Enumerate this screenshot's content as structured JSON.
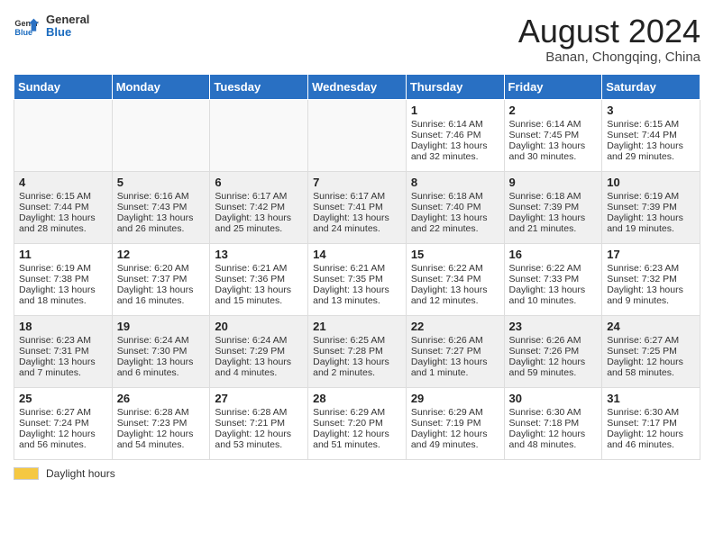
{
  "header": {
    "logo_line1": "General",
    "logo_line2": "Blue",
    "title": "August 2024",
    "subtitle": "Banan, Chongqing, China"
  },
  "weekdays": [
    "Sunday",
    "Monday",
    "Tuesday",
    "Wednesday",
    "Thursday",
    "Friday",
    "Saturday"
  ],
  "weeks": [
    [
      {
        "day": "",
        "text": ""
      },
      {
        "day": "",
        "text": ""
      },
      {
        "day": "",
        "text": ""
      },
      {
        "day": "",
        "text": ""
      },
      {
        "day": "1",
        "text": "Sunrise: 6:14 AM\nSunset: 7:46 PM\nDaylight: 13 hours\nand 32 minutes."
      },
      {
        "day": "2",
        "text": "Sunrise: 6:14 AM\nSunset: 7:45 PM\nDaylight: 13 hours\nand 30 minutes."
      },
      {
        "day": "3",
        "text": "Sunrise: 6:15 AM\nSunset: 7:44 PM\nDaylight: 13 hours\nand 29 minutes."
      }
    ],
    [
      {
        "day": "4",
        "text": "Sunrise: 6:15 AM\nSunset: 7:44 PM\nDaylight: 13 hours\nand 28 minutes."
      },
      {
        "day": "5",
        "text": "Sunrise: 6:16 AM\nSunset: 7:43 PM\nDaylight: 13 hours\nand 26 minutes."
      },
      {
        "day": "6",
        "text": "Sunrise: 6:17 AM\nSunset: 7:42 PM\nDaylight: 13 hours\nand 25 minutes."
      },
      {
        "day": "7",
        "text": "Sunrise: 6:17 AM\nSunset: 7:41 PM\nDaylight: 13 hours\nand 24 minutes."
      },
      {
        "day": "8",
        "text": "Sunrise: 6:18 AM\nSunset: 7:40 PM\nDaylight: 13 hours\nand 22 minutes."
      },
      {
        "day": "9",
        "text": "Sunrise: 6:18 AM\nSunset: 7:39 PM\nDaylight: 13 hours\nand 21 minutes."
      },
      {
        "day": "10",
        "text": "Sunrise: 6:19 AM\nSunset: 7:39 PM\nDaylight: 13 hours\nand 19 minutes."
      }
    ],
    [
      {
        "day": "11",
        "text": "Sunrise: 6:19 AM\nSunset: 7:38 PM\nDaylight: 13 hours\nand 18 minutes."
      },
      {
        "day": "12",
        "text": "Sunrise: 6:20 AM\nSunset: 7:37 PM\nDaylight: 13 hours\nand 16 minutes."
      },
      {
        "day": "13",
        "text": "Sunrise: 6:21 AM\nSunset: 7:36 PM\nDaylight: 13 hours\nand 15 minutes."
      },
      {
        "day": "14",
        "text": "Sunrise: 6:21 AM\nSunset: 7:35 PM\nDaylight: 13 hours\nand 13 minutes."
      },
      {
        "day": "15",
        "text": "Sunrise: 6:22 AM\nSunset: 7:34 PM\nDaylight: 13 hours\nand 12 minutes."
      },
      {
        "day": "16",
        "text": "Sunrise: 6:22 AM\nSunset: 7:33 PM\nDaylight: 13 hours\nand 10 minutes."
      },
      {
        "day": "17",
        "text": "Sunrise: 6:23 AM\nSunset: 7:32 PM\nDaylight: 13 hours\nand 9 minutes."
      }
    ],
    [
      {
        "day": "18",
        "text": "Sunrise: 6:23 AM\nSunset: 7:31 PM\nDaylight: 13 hours\nand 7 minutes."
      },
      {
        "day": "19",
        "text": "Sunrise: 6:24 AM\nSunset: 7:30 PM\nDaylight: 13 hours\nand 6 minutes."
      },
      {
        "day": "20",
        "text": "Sunrise: 6:24 AM\nSunset: 7:29 PM\nDaylight: 13 hours\nand 4 minutes."
      },
      {
        "day": "21",
        "text": "Sunrise: 6:25 AM\nSunset: 7:28 PM\nDaylight: 13 hours\nand 2 minutes."
      },
      {
        "day": "22",
        "text": "Sunrise: 6:26 AM\nSunset: 7:27 PM\nDaylight: 13 hours\nand 1 minute."
      },
      {
        "day": "23",
        "text": "Sunrise: 6:26 AM\nSunset: 7:26 PM\nDaylight: 12 hours\nand 59 minutes."
      },
      {
        "day": "24",
        "text": "Sunrise: 6:27 AM\nSunset: 7:25 PM\nDaylight: 12 hours\nand 58 minutes."
      }
    ],
    [
      {
        "day": "25",
        "text": "Sunrise: 6:27 AM\nSunset: 7:24 PM\nDaylight: 12 hours\nand 56 minutes."
      },
      {
        "day": "26",
        "text": "Sunrise: 6:28 AM\nSunset: 7:23 PM\nDaylight: 12 hours\nand 54 minutes."
      },
      {
        "day": "27",
        "text": "Sunrise: 6:28 AM\nSunset: 7:21 PM\nDaylight: 12 hours\nand 53 minutes."
      },
      {
        "day": "28",
        "text": "Sunrise: 6:29 AM\nSunset: 7:20 PM\nDaylight: 12 hours\nand 51 minutes."
      },
      {
        "day": "29",
        "text": "Sunrise: 6:29 AM\nSunset: 7:19 PM\nDaylight: 12 hours\nand 49 minutes."
      },
      {
        "day": "30",
        "text": "Sunrise: 6:30 AM\nSunset: 7:18 PM\nDaylight: 12 hours\nand 48 minutes."
      },
      {
        "day": "31",
        "text": "Sunrise: 6:30 AM\nSunset: 7:17 PM\nDaylight: 12 hours\nand 46 minutes."
      }
    ]
  ],
  "footer": {
    "label": "Daylight hours"
  }
}
